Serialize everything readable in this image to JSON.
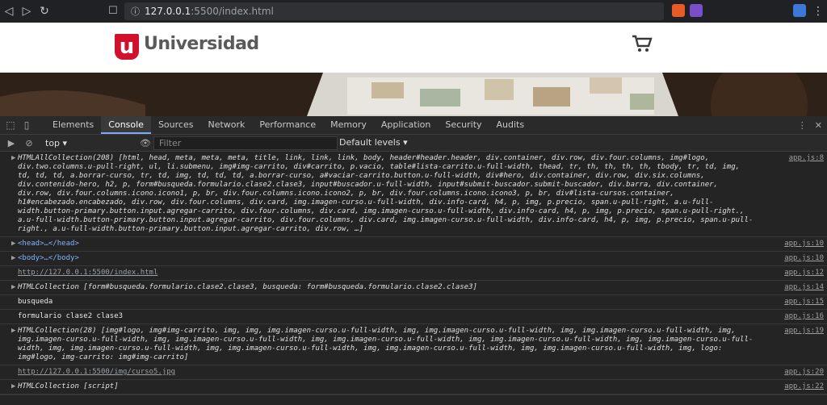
{
  "browser": {
    "url_host": "127.0.0.1",
    "url_rest": ":5500/index.html"
  },
  "site": {
    "logo_letter": "u",
    "logo_text": "Universidad"
  },
  "devtools": {
    "tabs": [
      "Elements",
      "Console",
      "Sources",
      "Network",
      "Performance",
      "Memory",
      "Application",
      "Security",
      "Audits"
    ],
    "active_tab": "Console",
    "context": "top",
    "filter_placeholder": "Filter",
    "levels": "Default levels",
    "rows": [
      {
        "text": "HTMLAllCollection(208) [html, head, meta, meta, meta, title, link, link, link, body, header#header.header, div.container, div.row, div.four.columns, img#logo, div.two.columns.u-pull-right, ul, li.submenu, img#img-carrito, div#carrito, p.vacio, table#lista-carrito.u-full-width, thead, tr, th, th, th, th, tbody, tr, td, img, td, td, td, a.borrar-curso, tr, td, img, td, td, td, a.borrar-curso, a#vaciar-carrito.button.u-full-width, div#hero, div.container, div.row, div.six.columns, div.contenido-hero, h2, p, form#busqueda.formulario.clase2.clase3, input#buscador.u-full-width, input#submit-buscador.submit-buscador, div.barra, div.container, div.row, div.four.columns.icono.icono1, p, br, div.four.columns.icono.icono2, p, br, div.four.columns.icono.icono3, p, br, div#lista-cursos.container, h1#encabezado.encabezado, div.row, div.four.columns, div.card, img.imagen-curso.u-full-width, div.info-card, h4, p, img, p.precio, span.u-pull-right, a.u-full-width.button-primary.button.input.agregar-carrito, div.four.columns, div.card, img.imagen-curso.u-full-width, div.info-card, h4, p, img, p.precio, span.u-pull-right., a.u-full-width.button-primary.button.input.agregar-carrito, div.four.columns, div.card, img.imagen-curso.u-full-width, div.info-card, h4, p, img, p.precio, span.u-pull-right., a.u-full-width.button-primary.button.input.agregar-carrito, div.row, …]",
        "src": "app.js:8",
        "style": "it",
        "arrow": "▶"
      },
      {
        "text": "<head>…</head>",
        "src": "app.js:10",
        "style": "tag",
        "arrow": "▶"
      },
      {
        "text": "<body>…</body>",
        "src": "app.js:10",
        "style": "tag",
        "arrow": "▶"
      },
      {
        "text": "http://127.0.0.1:5500/index.html",
        "src": "app.js:12",
        "style": "link",
        "arrow": ""
      },
      {
        "text": "HTMLCollection [form#busqueda.formulario.clase2.clase3, busqueda: form#busqueda.formulario.clase2.clase3]",
        "src": "app.js:14",
        "style": "it",
        "arrow": "▶"
      },
      {
        "text": "busqueda",
        "src": "app.js:15",
        "style": "plain",
        "arrow": ""
      },
      {
        "text": "formulario clase2 clase3",
        "src": "app.js:16",
        "style": "plain",
        "arrow": ""
      },
      {
        "text": "HTMLCollection(28) [img#logo, img#img-carrito, img, img, img.imagen-curso.u-full-width, img, img.imagen-curso.u-full-width, img, img.imagen-curso.u-full-width, img, img.imagen-curso.u-full-width, img, img.imagen-curso.u-full-width, img, img.imagen-curso.u-full-width, img, img.imagen-curso.u-full-width, img, img.imagen-curso.u-full-width, img, img.imagen-curso.u-full-width, img, img.imagen-curso.u-full-width, img, img.imagen-curso.u-full-width, img, img.imagen-curso.u-full-width, img, logo: img#logo, img-carrito: img#img-carrito]",
        "src": "app.js:19",
        "style": "it",
        "arrow": "▶"
      },
      {
        "text": "http://127.0.0.1:5500/img/curso5.jpg",
        "src": "app.js:20",
        "style": "link",
        "arrow": ""
      },
      {
        "text": "HTMLCollection [script]",
        "src": "app.js:22",
        "style": "it",
        "arrow": "▶"
      }
    ]
  }
}
